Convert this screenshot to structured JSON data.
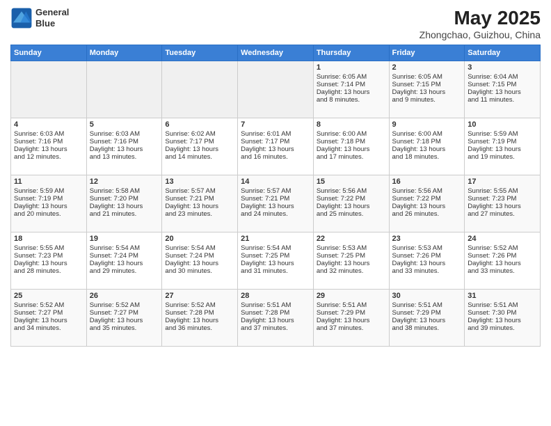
{
  "header": {
    "logo_line1": "General",
    "logo_line2": "Blue",
    "month": "May 2025",
    "location": "Zhongchao, Guizhou, China"
  },
  "days_of_week": [
    "Sunday",
    "Monday",
    "Tuesday",
    "Wednesday",
    "Thursday",
    "Friday",
    "Saturday"
  ],
  "weeks": [
    [
      {
        "day": "",
        "content": ""
      },
      {
        "day": "",
        "content": ""
      },
      {
        "day": "",
        "content": ""
      },
      {
        "day": "",
        "content": ""
      },
      {
        "day": "1",
        "content": "Sunrise: 6:05 AM\nSunset: 7:14 PM\nDaylight: 13 hours\nand 8 minutes."
      },
      {
        "day": "2",
        "content": "Sunrise: 6:05 AM\nSunset: 7:15 PM\nDaylight: 13 hours\nand 9 minutes."
      },
      {
        "day": "3",
        "content": "Sunrise: 6:04 AM\nSunset: 7:15 PM\nDaylight: 13 hours\nand 11 minutes."
      }
    ],
    [
      {
        "day": "4",
        "content": "Sunrise: 6:03 AM\nSunset: 7:16 PM\nDaylight: 13 hours\nand 12 minutes."
      },
      {
        "day": "5",
        "content": "Sunrise: 6:03 AM\nSunset: 7:16 PM\nDaylight: 13 hours\nand 13 minutes."
      },
      {
        "day": "6",
        "content": "Sunrise: 6:02 AM\nSunset: 7:17 PM\nDaylight: 13 hours\nand 14 minutes."
      },
      {
        "day": "7",
        "content": "Sunrise: 6:01 AM\nSunset: 7:17 PM\nDaylight: 13 hours\nand 16 minutes."
      },
      {
        "day": "8",
        "content": "Sunrise: 6:00 AM\nSunset: 7:18 PM\nDaylight: 13 hours\nand 17 minutes."
      },
      {
        "day": "9",
        "content": "Sunrise: 6:00 AM\nSunset: 7:18 PM\nDaylight: 13 hours\nand 18 minutes."
      },
      {
        "day": "10",
        "content": "Sunrise: 5:59 AM\nSunset: 7:19 PM\nDaylight: 13 hours\nand 19 minutes."
      }
    ],
    [
      {
        "day": "11",
        "content": "Sunrise: 5:59 AM\nSunset: 7:19 PM\nDaylight: 13 hours\nand 20 minutes."
      },
      {
        "day": "12",
        "content": "Sunrise: 5:58 AM\nSunset: 7:20 PM\nDaylight: 13 hours\nand 21 minutes."
      },
      {
        "day": "13",
        "content": "Sunrise: 5:57 AM\nSunset: 7:21 PM\nDaylight: 13 hours\nand 23 minutes."
      },
      {
        "day": "14",
        "content": "Sunrise: 5:57 AM\nSunset: 7:21 PM\nDaylight: 13 hours\nand 24 minutes."
      },
      {
        "day": "15",
        "content": "Sunrise: 5:56 AM\nSunset: 7:22 PM\nDaylight: 13 hours\nand 25 minutes."
      },
      {
        "day": "16",
        "content": "Sunrise: 5:56 AM\nSunset: 7:22 PM\nDaylight: 13 hours\nand 26 minutes."
      },
      {
        "day": "17",
        "content": "Sunrise: 5:55 AM\nSunset: 7:23 PM\nDaylight: 13 hours\nand 27 minutes."
      }
    ],
    [
      {
        "day": "18",
        "content": "Sunrise: 5:55 AM\nSunset: 7:23 PM\nDaylight: 13 hours\nand 28 minutes."
      },
      {
        "day": "19",
        "content": "Sunrise: 5:54 AM\nSunset: 7:24 PM\nDaylight: 13 hours\nand 29 minutes."
      },
      {
        "day": "20",
        "content": "Sunrise: 5:54 AM\nSunset: 7:24 PM\nDaylight: 13 hours\nand 30 minutes."
      },
      {
        "day": "21",
        "content": "Sunrise: 5:54 AM\nSunset: 7:25 PM\nDaylight: 13 hours\nand 31 minutes."
      },
      {
        "day": "22",
        "content": "Sunrise: 5:53 AM\nSunset: 7:25 PM\nDaylight: 13 hours\nand 32 minutes."
      },
      {
        "day": "23",
        "content": "Sunrise: 5:53 AM\nSunset: 7:26 PM\nDaylight: 13 hours\nand 33 minutes."
      },
      {
        "day": "24",
        "content": "Sunrise: 5:52 AM\nSunset: 7:26 PM\nDaylight: 13 hours\nand 33 minutes."
      }
    ],
    [
      {
        "day": "25",
        "content": "Sunrise: 5:52 AM\nSunset: 7:27 PM\nDaylight: 13 hours\nand 34 minutes."
      },
      {
        "day": "26",
        "content": "Sunrise: 5:52 AM\nSunset: 7:27 PM\nDaylight: 13 hours\nand 35 minutes."
      },
      {
        "day": "27",
        "content": "Sunrise: 5:52 AM\nSunset: 7:28 PM\nDaylight: 13 hours\nand 36 minutes."
      },
      {
        "day": "28",
        "content": "Sunrise: 5:51 AM\nSunset: 7:28 PM\nDaylight: 13 hours\nand 37 minutes."
      },
      {
        "day": "29",
        "content": "Sunrise: 5:51 AM\nSunset: 7:29 PM\nDaylight: 13 hours\nand 37 minutes."
      },
      {
        "day": "30",
        "content": "Sunrise: 5:51 AM\nSunset: 7:29 PM\nDaylight: 13 hours\nand 38 minutes."
      },
      {
        "day": "31",
        "content": "Sunrise: 5:51 AM\nSunset: 7:30 PM\nDaylight: 13 hours\nand 39 minutes."
      }
    ]
  ]
}
